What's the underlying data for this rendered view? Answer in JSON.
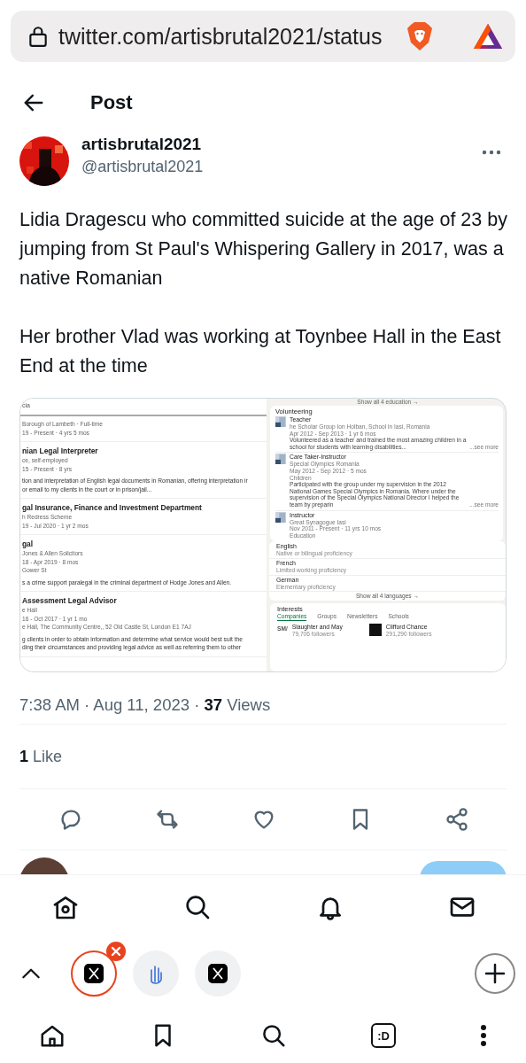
{
  "url_bar": {
    "url": "twitter.com/artisbrutal2021/status"
  },
  "header": {
    "title": "Post"
  },
  "post": {
    "author": {
      "name": "artisbrutal2021",
      "handle": "@artisbrutal2021"
    },
    "paragraphs": [
      "Lidia Dragescu who committed suicide at the age of 23 by jumping from St Paul's Whispering Gallery in 2017, was a native Romanian",
      "Her brother Vlad was working at Toynbee Hall in the East End at the time"
    ],
    "media": {
      "experience": {
        "header": "cia",
        "entries": [
          {
            "lines": [
              "Borough of Lambeth · Full-time",
              "19 - Present · 4 yrs 5 mos"
            ]
          },
          {
            "title": "nian Legal Interpreter",
            "lines": [
              "ce, self-employed",
              "15 - Present · 8 yrs"
            ],
            "description": [
              "tion and interpretation of English legal documents in Romanian, offering interpretation ir",
              "or email to my clients in the court or in prison/jail..."
            ]
          },
          {
            "title": "gal Insurance, Finance and Investment Department",
            "lines": [
              "h Redress Scheme",
              "19 - Jul 2020 · 1 yr 2 mos"
            ]
          },
          {
            "title": "gal",
            "lines": [
              "Jones & Allen Solicitors",
              "18 - Apr 2019 · 8 mos",
              "Gower St"
            ],
            "description": [
              "s a crime support paralegal in the criminal department of Hodge Jones and Allen."
            ]
          },
          {
            "title": "Assessment Legal Advisor",
            "lines": [
              "e Hall",
              "16 - Oct 2017 · 1 yr 1 mo",
              "e Hall, The Community Centre,, 52 Old Castle St, London E1 7AJ"
            ],
            "description": [
              "g clients in order to obtain information and determine what service would best suit the",
              "ding their circumstances and providing legal advice as well as referring them to other"
            ]
          }
        ]
      },
      "education_link": "Show all 4 education →",
      "volunteering": {
        "title": "Volunteering",
        "entries": [
          {
            "title": "Teacher",
            "lines": [
              "he Scholar Group Ion Holban, School in Iasi, Romania",
              "Apr 2012 - Sep 2013 · 1 yr 6 mos"
            ],
            "description": "Volunteered as a teacher and trained the most amazing children in a school for students with learning disabilities...",
            "see_more": "...see more"
          },
          {
            "title": "Care Taker-Instructor",
            "lines": [
              "Special Olympics Romania",
              "May 2012 - Sep 2012 · 5 mos",
              "Children"
            ],
            "description": "Participated with the group under my supervision in the 2012 National Games Special Olympics in Romania. Where under the supervision of the Special Olympics National Director I helped the team by preparin",
            "see_more": "...see more"
          },
          {
            "title": "Instructor",
            "lines": [
              "Great Synagogue Iasi",
              "Nov 2011 - Present · 11 yrs 10 mos",
              "Education"
            ]
          }
        ]
      },
      "languages": {
        "items": [
          {
            "name": "English",
            "proficiency": "Native or bilingual proficiency"
          },
          {
            "name": "French",
            "proficiency": "Limited working proficiency"
          },
          {
            "name": "German",
            "proficiency": "Elementary proficiency"
          }
        ],
        "link": "Show all 4 languages →"
      },
      "interests": {
        "title": "Interests",
        "tabs": [
          {
            "label": "Companies",
            "selected": true
          },
          {
            "label": "Groups",
            "selected": false
          },
          {
            "label": "Newsletters",
            "selected": false
          },
          {
            "label": "Schools",
            "selected": false
          }
        ],
        "items": [
          {
            "logo": "SM/",
            "name": "Slaughter and May",
            "followers": "79,706 followers"
          },
          {
            "name": "Clifford Chance",
            "followers": "291,290 followers"
          }
        ]
      }
    },
    "meta": "7:38 AM · Aug 11, 2023 · **37** Views",
    "likes": "**1** Like"
  },
  "browser_tabs": [
    {
      "kind": "x",
      "selected": true
    },
    {
      "kind": "hand",
      "selected": false
    },
    {
      "kind": "x",
      "selected": false
    }
  ],
  "browser_bar": {
    "tabs_label": ":D"
  }
}
